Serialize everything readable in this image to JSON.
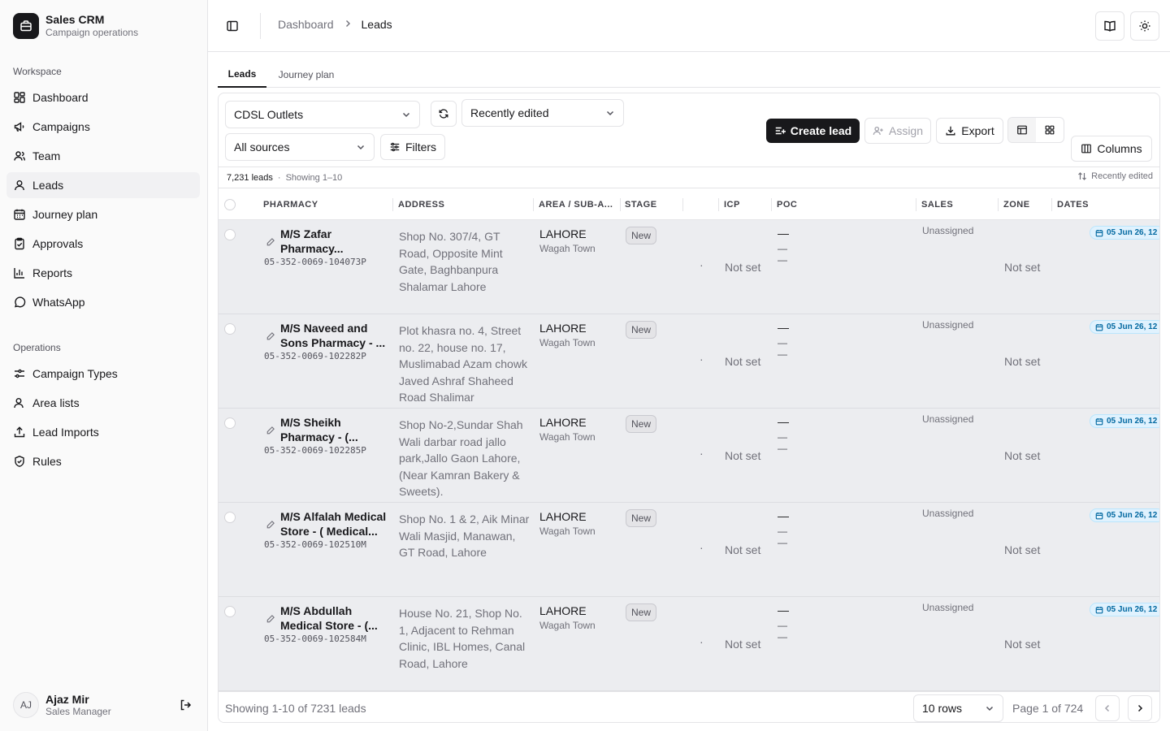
{
  "brand": {
    "title": "Sales CRM",
    "subtitle": "Campaign operations"
  },
  "sidebar": {
    "workspace_label": "Workspace",
    "workspace": [
      {
        "label": "Dashboard",
        "icon": "dashboard-icon"
      },
      {
        "label": "Campaigns",
        "icon": "megaphone-icon"
      },
      {
        "label": "Team",
        "icon": "team-icon"
      },
      {
        "label": "Leads",
        "icon": "user-icon",
        "active": true
      },
      {
        "label": "Journey plan",
        "icon": "calendar-icon"
      },
      {
        "label": "Approvals",
        "icon": "clipboard-check-icon"
      },
      {
        "label": "Reports",
        "icon": "bar-chart-icon"
      },
      {
        "label": "WhatsApp",
        "icon": "message-circle-icon"
      }
    ],
    "operations_label": "Operations",
    "operations": [
      {
        "label": "Campaign Types",
        "icon": "sliders-icon"
      },
      {
        "label": "Area lists",
        "icon": "user-list-icon"
      },
      {
        "label": "Lead Imports",
        "icon": "upload-icon"
      },
      {
        "label": "Rules",
        "icon": "shield-icon"
      }
    ]
  },
  "user": {
    "initials": "AJ",
    "name": "Ajaz Mir",
    "role": "Sales Manager"
  },
  "header": {
    "breadcrumb": [
      "Dashboard",
      "Leads"
    ]
  },
  "tabs": [
    {
      "label": "Leads",
      "active": true
    },
    {
      "label": "Journey plan"
    }
  ],
  "toolbar": {
    "campaign_select": "CDSL Outlets",
    "sort_select": "Recently edited",
    "source_select": "All sources",
    "filters_label": "Filters",
    "create_label": "Create lead",
    "assign_label": "Assign",
    "export_label": "Export",
    "columns_label": "Columns"
  },
  "meta": {
    "count": "7,231 leads",
    "separator": "·",
    "showing": "Showing 1–10",
    "sort": "Recently edited"
  },
  "columns": [
    "PHARMACY",
    "ADDRESS",
    "AREA / SUB-A...",
    "STAGE",
    "ICP",
    "POC",
    "SALES",
    "ZONE",
    "DATES"
  ],
  "rows": [
    {
      "name": "M/S Zafar Pharmacy...",
      "code": "05-352-0069-104073P",
      "address": "Shop No. 307/4, GT Road, Opposite Mint Gate, Baghbanpura Shalamar Lahore",
      "area": "LAHORE",
      "subarea": "Wagah Town",
      "stage": "New",
      "dot": "·",
      "icp": "Not set",
      "poc": "—",
      "sales": "Unassigned",
      "zone": "Not set",
      "date": "05 Jun 26, 12"
    },
    {
      "name": "M/S Naveed and Sons Pharmacy - ...",
      "code": "05-352-0069-102282P",
      "address": "Plot khasra no. 4, Street no. 22, house no. 17, Muslimabad Azam chowk Javed Ashraf Shaheed Road Shalimar",
      "area": "LAHORE",
      "subarea": "Wagah Town",
      "stage": "New",
      "dot": "·",
      "icp": "Not set",
      "poc": "—",
      "sales": "Unassigned",
      "zone": "Not set",
      "date": "05 Jun 26, 12"
    },
    {
      "name": "M/S Sheikh Pharmacy - (...",
      "code": "05-352-0069-102285P",
      "address": "Shop No-2,Sundar Shah Wali darbar road jallo park,Jallo Gaon Lahore,(Near Kamran Bakery & Sweets).",
      "area": "LAHORE",
      "subarea": "Wagah Town",
      "stage": "New",
      "dot": "·",
      "icp": "Not set",
      "poc": "—",
      "sales": "Unassigned",
      "zone": "Not set",
      "date": "05 Jun 26, 12"
    },
    {
      "name": "M/S Alfalah Medical Store - ( Medical...",
      "code": "05-352-0069-102510M",
      "address": "Shop No. 1 & 2, Aik Minar Wali Masjid, Manawan, GT Road, Lahore",
      "area": "LAHORE",
      "subarea": "Wagah Town",
      "stage": "New",
      "dot": "·",
      "icp": "Not set",
      "poc": "—",
      "sales": "Unassigned",
      "zone": "Not set",
      "date": "05 Jun 26, 12"
    },
    {
      "name": "M/S Abdullah Medical Store - (...",
      "code": "05-352-0069-102584M",
      "address": "House No. 21, Shop No. 1, Adjacent to Rehman Clinic, IBL Homes, Canal Road, Lahore",
      "area": "LAHORE",
      "subarea": "Wagah Town",
      "stage": "New",
      "dot": "·",
      "icp": "Not set",
      "poc": "—",
      "sales": "Unassigned",
      "zone": "Not set",
      "date": "05 Jun 26, 12"
    }
  ],
  "footer": {
    "showing": "Showing 1-10 of 7231 leads",
    "rows_select": "10 rows",
    "page_label": "Page 1 of 724"
  }
}
